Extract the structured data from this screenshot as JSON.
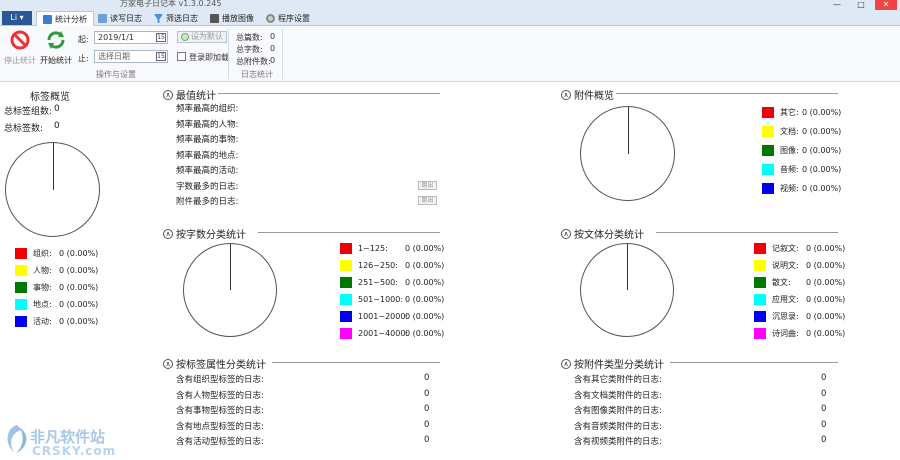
{
  "window": {
    "title": "万家电子日记本 v1.3.0.245",
    "min": "—",
    "max": "□",
    "close": "✕"
  },
  "file_menu": {
    "label": "Li ▾"
  },
  "tabs": [
    {
      "label": "统计分析",
      "active": true
    },
    {
      "label": "读写日志"
    },
    {
      "label": "筛选日志"
    },
    {
      "label": "播放图像"
    },
    {
      "label": "程序设置"
    }
  ],
  "ribbon": {
    "stop_label": "停止统计",
    "start_label": "开始统计",
    "from_label": "起:",
    "to_label": "止:",
    "from_value": "2019/1/1",
    "to_value": "选择日期",
    "set_default_label": "设为默认",
    "login_load_label": "登录即加载",
    "cal_glyph": "15",
    "group_ops": "操作与设置",
    "summary": [
      {
        "label": "总篇数:",
        "value": "0"
      },
      {
        "label": "总字数:",
        "value": "0"
      },
      {
        "label": "总附件数:",
        "value": "0"
      }
    ],
    "group_summary": "日志统计"
  },
  "tag_overview": {
    "title": "标签概览",
    "total_groups_label": "总标签组数:",
    "total_groups": "0",
    "total_tags_label": "总标签数:",
    "total_tags": "0",
    "legend": [
      {
        "label": "组织:",
        "value": "0 (0.00%)",
        "color": "#ee0000"
      },
      {
        "label": "人物:",
        "value": "0 (0.00%)",
        "color": "#ffff00"
      },
      {
        "label": "事物:",
        "value": "0 (0.00%)",
        "color": "#007700"
      },
      {
        "label": "地点:",
        "value": "0 (0.00%)",
        "color": "#00ffff"
      },
      {
        "label": "活动:",
        "value": "0 (0.00%)",
        "color": "#0000ee"
      }
    ]
  },
  "extreme_stats": {
    "title": "最值统计",
    "toggle": "∧",
    "jump_label": "跳出",
    "rows": [
      "频率最高的组织:",
      "频率最高的人物:",
      "频率最高的事物:",
      "频率最高的地点:",
      "频率最高的活动:",
      "字数最多的日志:",
      "附件最多的日志:"
    ]
  },
  "word_count": {
    "title": "按字数分类统计",
    "toggle": "∧",
    "legend": [
      {
        "label": "1~125:",
        "value": "0 (0.00%)",
        "color": "#ee0000"
      },
      {
        "label": "126~250:",
        "value": "0 (0.00%)",
        "color": "#ffff00"
      },
      {
        "label": "251~500:",
        "value": "0 (0.00%)",
        "color": "#007700"
      },
      {
        "label": "501~1000:",
        "value": "0 (0.00%)",
        "color": "#00ffff"
      },
      {
        "label": "1001~2000:",
        "value": "0 (0.00%)",
        "color": "#0000ee"
      },
      {
        "label": "2001~4000:",
        "value": "0 (0.00%)",
        "color": "#ff00ff"
      }
    ]
  },
  "tag_attr": {
    "title": "按标签属性分类统计",
    "toggle": "∧",
    "rows": [
      {
        "label": "含有组织型标签的日志:",
        "value": "0"
      },
      {
        "label": "含有人物型标签的日志:",
        "value": "0"
      },
      {
        "label": "含有事物型标签的日志:",
        "value": "0"
      },
      {
        "label": "含有地点型标签的日志:",
        "value": "0"
      },
      {
        "label": "含有活动型标签的日志:",
        "value": "0"
      }
    ]
  },
  "attachment_overview": {
    "title": "附件概览",
    "toggle": "∧",
    "legend": [
      {
        "label": "其它:",
        "value": "0 (0.00%)",
        "color": "#ee0000"
      },
      {
        "label": "文档:",
        "value": "0 (0.00%)",
        "color": "#ffff00"
      },
      {
        "label": "图像:",
        "value": "0 (0.00%)",
        "color": "#007700"
      },
      {
        "label": "音频:",
        "value": "0 (0.00%)",
        "color": "#00ffff"
      },
      {
        "label": "视频:",
        "value": "0 (0.00%)",
        "color": "#0000ee"
      }
    ]
  },
  "genre": {
    "title": "按文体分类统计",
    "toggle": "∧",
    "legend": [
      {
        "label": "记叙文:",
        "value": "0 (0.00%)",
        "color": "#ee0000"
      },
      {
        "label": "说明文:",
        "value": "0 (0.00%)",
        "color": "#ffff00"
      },
      {
        "label": "散文:",
        "value": "0 (0.00%)",
        "color": "#007700"
      },
      {
        "label": "应用文:",
        "value": "0 (0.00%)",
        "color": "#00ffff"
      },
      {
        "label": "沉思录:",
        "value": "0 (0.00%)",
        "color": "#0000ee"
      },
      {
        "label": "诗词曲:",
        "value": "0 (0.00%)",
        "color": "#ff00ff"
      }
    ]
  },
  "attach_type": {
    "title": "按附件类型分类统计",
    "toggle": "∧",
    "rows": [
      {
        "label": "含有其它类附件的日志:",
        "value": "0"
      },
      {
        "label": "含有文档类附件的日志:",
        "value": "0"
      },
      {
        "label": "含有图像类附件的日志:",
        "value": "0"
      },
      {
        "label": "含有音频类附件的日志:",
        "value": "0"
      },
      {
        "label": "含有视频类附件的日志:",
        "value": "0"
      }
    ]
  },
  "watermark": {
    "cn": "非凡软件站",
    "en": "CRSKY.com"
  }
}
